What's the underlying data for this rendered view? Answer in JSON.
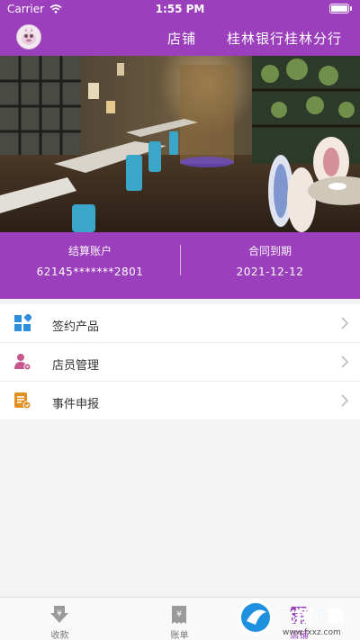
{
  "status_bar": {
    "carrier": "Carrier",
    "time": "1:55 PM",
    "battery_level": 1.0
  },
  "header": {
    "title": "店铺",
    "bank_name": "桂林银行桂林分行",
    "avatar_icon": "merchant-avatar-icon"
  },
  "account": {
    "settlement_label": "结算账户",
    "settlement_value": "62145*******2801",
    "contract_label": "合同到期",
    "contract_value": "2021-12-12"
  },
  "menu": {
    "items": [
      {
        "label": "签约产品",
        "icon": "signed-products-icon",
        "color": "#2f8fdc"
      },
      {
        "label": "店员管理",
        "icon": "staff-management-icon",
        "color": "#c9558e"
      },
      {
        "label": "事件申报",
        "icon": "event-report-icon",
        "color": "#e08f20"
      }
    ]
  },
  "tabbar": {
    "tabs": [
      {
        "label": "收款",
        "icon": "receive-payment-icon"
      },
      {
        "label": "账单",
        "icon": "bill-icon"
      },
      {
        "label": "店铺",
        "icon": "shop-icon",
        "active": true
      }
    ]
  },
  "watermark": {
    "text": "飞翔下载",
    "url": "www.fxxz.com"
  },
  "colors": {
    "primary": "#9c3fbd",
    "background": "#f3f3f3",
    "menu_text": "#333333",
    "chevron": "#bbbbbb"
  }
}
